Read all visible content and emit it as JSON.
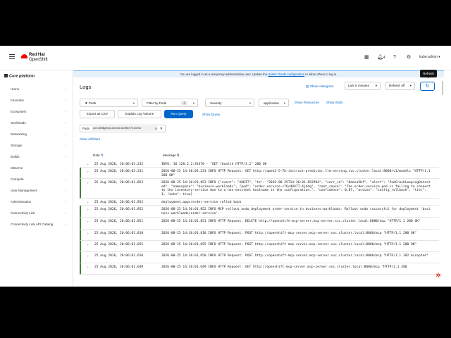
{
  "masthead": {
    "brand_line1": "Red Hat",
    "brand_line2": "OpenShift",
    "apps_icon": "grid-icon",
    "notifications_count": "4",
    "help_icon": "help-icon",
    "user": "kube:admin"
  },
  "sidebar": {
    "perspective": "Core platform",
    "items": [
      {
        "label": "Home"
      },
      {
        "label": "Favorites"
      },
      {
        "label": "Ecosystem"
      },
      {
        "label": "Workloads"
      },
      {
        "label": "Networking"
      },
      {
        "label": "Storage"
      },
      {
        "label": "Builds"
      },
      {
        "label": "Observe"
      },
      {
        "label": "Compute"
      },
      {
        "label": "User Management"
      },
      {
        "label": "Administration"
      },
      {
        "label": "Connectivity Link"
      },
      {
        "label": "Connectivity Link API Catalog"
      }
    ]
  },
  "banner": {
    "text_before": "You are logged in as a temporary administrative user. Update the ",
    "link": "cluster OAuth configuration",
    "text_after": " to allow others to log in."
  },
  "tooltip": "Refresh",
  "page": {
    "title": "Logs",
    "show_histogram": "Show Histogram",
    "time_range": "Last 5 minutes",
    "refresh": "Refresh off"
  },
  "filters": {
    "resource_select": "Pods",
    "filter_by": "Filter by Pods",
    "filter_count": "1",
    "severity": "Severity",
    "log_type": "application",
    "show_resources": "Show Resources",
    "show_stats": "Show Stats",
    "export_csv": "Export as CSV",
    "explain_volume": "Explain Log Volume",
    "run_query": "Run Query",
    "show_query": "Show Query",
    "chip_group_label": "Pods",
    "chip_value": "ure-intelligence-service-6c95b779-5x7kx",
    "clear_all": "Clear all filters"
  },
  "table": {
    "col_date": "Date",
    "col_message": "Message",
    "rows": [
      {
        "date": "25 Aug 2026, 20:06:03.232",
        "message": "INFO: 10.128.2.2:35470 - \"GET /health HTTP/1.1\" 200 OK",
        "marker": false
      },
      {
        "date": "25 Aug 2026, 20:06:03.231",
        "message": "2026-08-25 14:36:03,231 INFO HTTP Request: GET http://qwen2-5-7b-instruct-predictor.llm-serving.svc.cluster.local:8080/v1/models \"HTTP/1.1 200 OK\"",
        "marker": true
      },
      {
        "date": "25 Aug 2026, 20:06:01.853",
        "message": "2026-08-25 14:36:01,853 INFO {\"event\": \"AUDIT\", \"ts\": \"2026-08-25T14:36:01.852994\", \"corr_id\": \"0daca5bf\", \"alert\": \"PodCrashLoopingDetected\", \"namespace\": \"business-workloads\", \"pod\": \"order-service-c76cd9477-4jddg\", \"root_cause\": \"The order-service pod is failing to connect to the inventory-service due to a non-existent hostname in the configuration.\", \"confidence\": 0.87, \"action\": \"config_rollback\", \"tier\": 1, \"auto\": true}",
        "marker": true
      },
      {
        "date": "25 Aug 2026, 20:06:01.852",
        "message": "deployment.apps/order-service rolled back",
        "marker": false
      },
      {
        "date": "25 Aug 2026, 20:06:01.852",
        "message": "2026-08-25 14:36:01,852 INFO MCP rollout_undo_deployment order-service in business-workloads: Rollout undo successful for deployment 'business-workloads/order-service'.",
        "marker": true
      },
      {
        "date": "25 Aug 2026, 20:06:01.851",
        "message": "2026-08-25 14:36:01,851 INFO HTTP Request: DELETE http://openshift-mcp-server.mcp-server.svc.cluster.local:8080/mcp \"HTTP/1.1 200 OK\"",
        "marker": true
      },
      {
        "date": "25 Aug 2026, 20:06:01.818",
        "message": "2026-08-25 14:36:01,818 INFO HTTP Request: POST http://openshift-mcp-server.mcp-server.svc.cluster.local:8080/mcp \"HTTP/1.1 200 OK\"",
        "marker": true
      },
      {
        "date": "25 Aug 2026, 20:06:01.655",
        "message": "2026-08-25 14:36:01,655 INFO HTTP Request: POST http://openshift-mcp-server.mcp-server.svc.cluster.local:8080/mcp \"HTTP/1.1 200 OK\"",
        "marker": true
      },
      {
        "date": "25 Aug 2026, 20:06:01.650",
        "message": "2026-08-25 14:36:01,650 INFO HTTP Request: POST http://openshift-mcp-server.mcp-server.svc.cluster.local:8080/mcp \"HTTP/1.1 202 Accepted\"",
        "marker": true
      },
      {
        "date": "25 Aug 2026, 20:06:01.649",
        "message": "2026-08-25 14:36:01,649 INFO HTTP Request: GET http://openshift-mcp-server.mcp-server.svc.cluster.local:8080/mcp \"HTTP/1.1 200",
        "marker": true
      }
    ]
  }
}
